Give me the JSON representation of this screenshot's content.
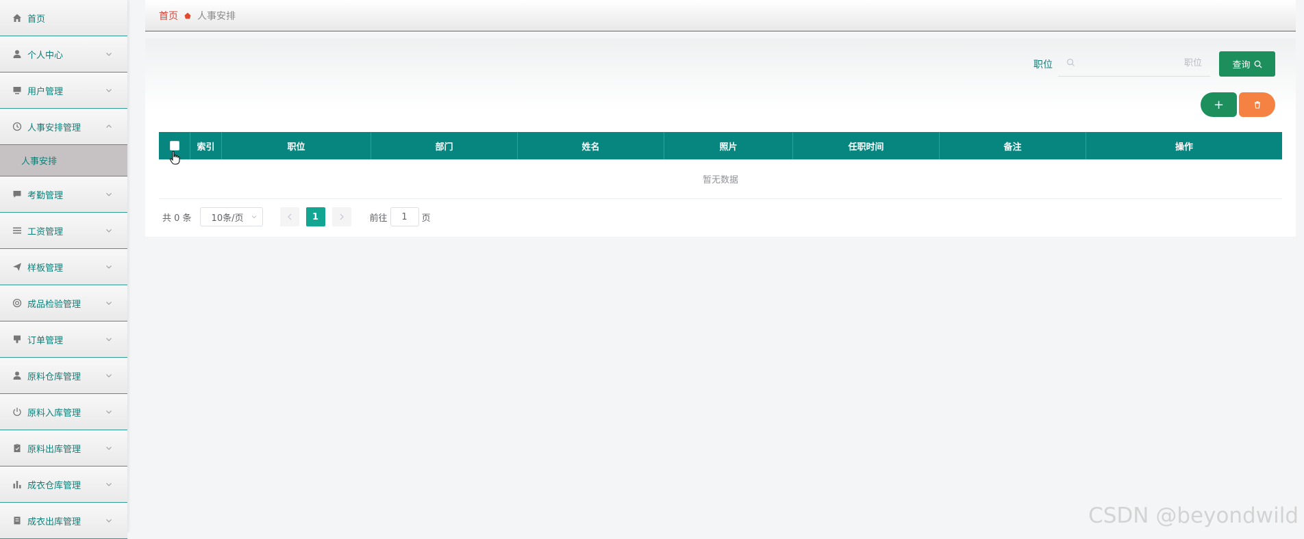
{
  "sidebar": {
    "items": [
      {
        "label": "首页",
        "icon": "home-icon",
        "expanded": false,
        "has_arrow": false
      },
      {
        "label": "个人中心",
        "icon": "user-icon",
        "has_arrow": true
      },
      {
        "label": "用户管理",
        "icon": "monitor-icon",
        "has_arrow": true
      },
      {
        "label": "人事安排管理",
        "icon": "clock-icon",
        "has_arrow": true,
        "expanded": true,
        "children": [
          {
            "label": "人事安排"
          }
        ]
      },
      {
        "label": "考勤管理",
        "icon": "chat-icon",
        "has_arrow": true
      },
      {
        "label": "工资管理",
        "icon": "list-icon",
        "has_arrow": true
      },
      {
        "label": "样板管理",
        "icon": "send-icon",
        "has_arrow": true
      },
      {
        "label": "成品检验管理",
        "icon": "help-ring-icon",
        "has_arrow": true
      },
      {
        "label": "订单管理",
        "icon": "stamp-icon",
        "has_arrow": true
      },
      {
        "label": "原料仓库管理",
        "icon": "user-icon",
        "has_arrow": true
      },
      {
        "label": "原料入库管理",
        "icon": "power-icon",
        "has_arrow": true
      },
      {
        "label": "原料出库管理",
        "icon": "clipboard-icon",
        "has_arrow": true
      },
      {
        "label": "成衣仓库管理",
        "icon": "bar-chart-icon",
        "has_arrow": true
      },
      {
        "label": "成衣出库管理",
        "icon": "document-icon",
        "has_arrow": true
      }
    ]
  },
  "breadcrumb": {
    "home": "首页",
    "current": "人事安排"
  },
  "search": {
    "label": "职位",
    "placeholder": "职位",
    "value": "",
    "button_label": "查询"
  },
  "actions": {
    "add_label": "+"
  },
  "table": {
    "columns": [
      "索引",
      "职位",
      "部门",
      "姓名",
      "照片",
      "任职时间",
      "备注",
      "操作"
    ],
    "empty_text": "暂无数据"
  },
  "pagination": {
    "total_text": "共 0 条",
    "page_size": "10条/页",
    "current_page": "1",
    "goto_prefix": "前往",
    "goto_value": "1",
    "goto_suffix": "页"
  },
  "watermark": "CSDN @beyondwild",
  "colors": {
    "primary": "#07867f",
    "accent_green": "#1c8f5d",
    "danger_orange": "#f58242",
    "active_page": "#12a592"
  }
}
